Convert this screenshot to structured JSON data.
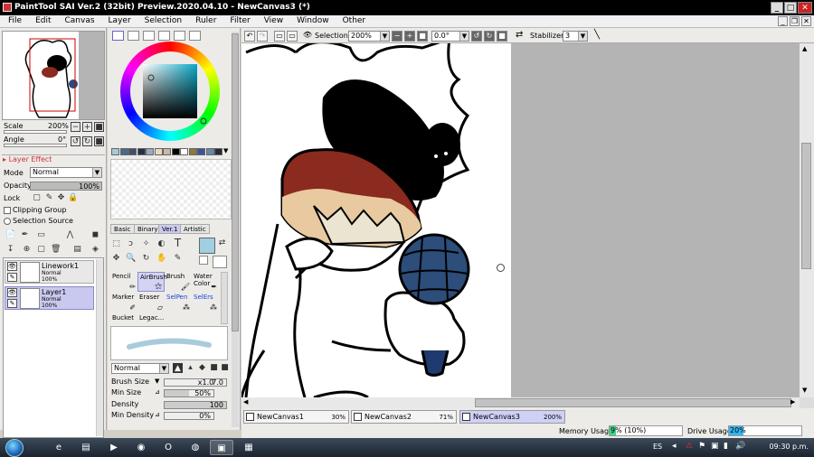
{
  "window": {
    "title": "PaintTool SAI Ver.2 (32bit) Preview.2020.04.10 - NewCanvas3 (*)",
    "min": "_",
    "max": "□",
    "close": "✕"
  },
  "menu": [
    "File",
    "Edit",
    "Canvas",
    "Layer",
    "Selection",
    "Ruler",
    "Filter",
    "View",
    "Window",
    "Other"
  ],
  "navigator": {
    "scale_label": "Scale",
    "scale_value": "200%",
    "angle_label": "Angle",
    "angle_value": "0°"
  },
  "layer_effect": {
    "header": "Layer Effect",
    "mode_label": "Mode",
    "mode_value": "Normal",
    "opacity_label": "Opacity",
    "opacity_value": "100%",
    "opacity_fraction": 1.0,
    "lock_label": "Lock",
    "clipping_label": "Clipping Group",
    "selection_source_label": "Selection Source"
  },
  "layers": [
    {
      "name": "Linework1",
      "mode": "Normal",
      "opacity": "100%",
      "selected": false
    },
    {
      "name": "Layer1",
      "mode": "Normal",
      "opacity": "100%",
      "selected": true
    }
  ],
  "colors": {
    "hue_wheel": "conic",
    "sv_base": "#0aa8c8",
    "current": "#9fcfe0",
    "swatches": [
      "#a8c8d8",
      "#4a6a8a",
      "#405070",
      "#283048",
      "#9aaabf",
      "#e8d8c0",
      "#c8b8a8",
      "#000000",
      "#ffffff",
      "#8a7a40",
      "#4050a0",
      "#6888a8",
      "#282838"
    ]
  },
  "brush_tabs": [
    "Basic",
    "Binary",
    "Ver.1",
    "Artistic"
  ],
  "brush_tab_selected": "Ver.1",
  "tools": [
    {
      "label": "Pencil",
      "blue": false
    },
    {
      "label": "AirBrush",
      "blue": false,
      "selected": true
    },
    {
      "label": "Brush",
      "blue": false
    },
    {
      "label": "Water Color",
      "blue": false
    },
    {
      "label": "Marker",
      "blue": false
    },
    {
      "label": "Eraser",
      "blue": false
    },
    {
      "label": "SelPen",
      "blue": true
    },
    {
      "label": "SelErs",
      "blue": true
    },
    {
      "label": "Bucket",
      "blue": false
    },
    {
      "label": "Legac...",
      "blue": false
    }
  ],
  "brush": {
    "blend_mode": "Normal",
    "size_label": "Brush Size",
    "size_mult": "x1.0",
    "size_value": "7.0",
    "min_size_label": "Min Size",
    "min_size_value": "50%",
    "min_size_fraction": 0.5,
    "density_label": "Density",
    "density_value": "100",
    "density_fraction": 1.0,
    "min_density_label": "Min Density",
    "min_density_value": "0%",
    "min_density_fraction": 0.0
  },
  "toolbar": {
    "selection_label": "Selection",
    "zoom_value": "200%",
    "angle_value": "0.0°",
    "stabilizer_label": "Stabilizer",
    "stabilizer_value": "3"
  },
  "doc_tabs": [
    {
      "name": "NewCanvas1",
      "zoom": "30%",
      "selected": false
    },
    {
      "name": "NewCanvas2",
      "zoom": "71%",
      "selected": false
    },
    {
      "name": "NewCanvas3",
      "zoom": "200%",
      "selected": true
    }
  ],
  "status": {
    "memory_label": "Memory Usage",
    "memory_value": "9% (10%)",
    "memory_fraction": 0.09,
    "drive_label": "Drive Usage",
    "drive_value": "20%",
    "drive_fraction": 0.2
  },
  "taskbar": {
    "lang": "ES",
    "time": "09:30 p.m."
  }
}
